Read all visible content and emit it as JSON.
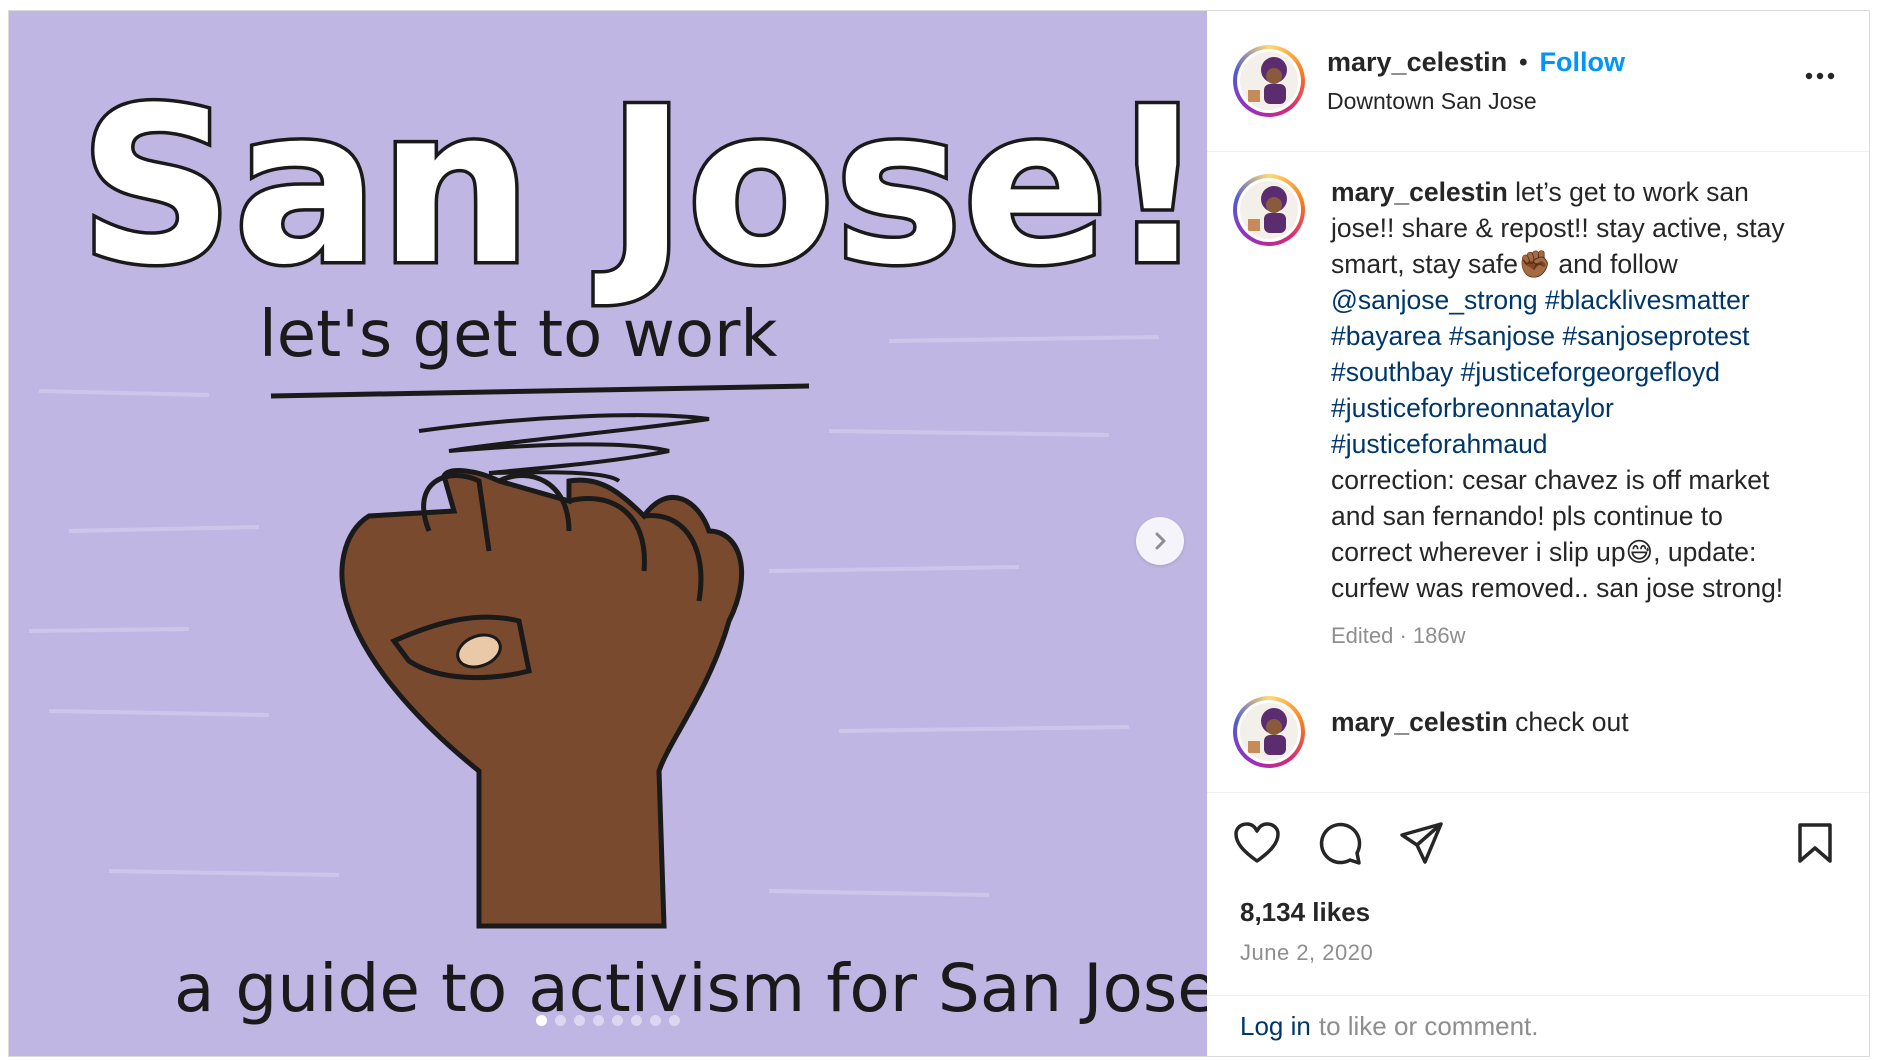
{
  "post": {
    "image": {
      "title_text": "San Jose!",
      "subtitle_text": "let's get to work",
      "footer_text": "a guide to activism for San Jose",
      "background_color": "#c0b6e3",
      "carousel_dots_total": 8,
      "carousel_active_index": 0
    },
    "header": {
      "username": "mary_celestin",
      "separator": "•",
      "follow_label": "Follow",
      "location": "Downtown San Jose",
      "more_icon": "more-horizontal-icon"
    },
    "caption": {
      "username": "mary_celestin",
      "text_1": " let’s get to work san jose!! share & repost!! stay active, stay smart, stay safe✊🏾 and follow ",
      "mention": "@sanjose_strong",
      "hashtags": [
        "#blacklivesmatter",
        "#bayarea",
        "#sanjose",
        "#sanjoseprotest",
        "#southbay",
        "#justiceforgeorgefloyd",
        "#justiceforbreonnataylor",
        "#justiceforahmaud"
      ],
      "text_2": "correction: cesar chavez is off market and san fernando! pls continue to correct wherever i slip up😅, update: curfew was removed.. san jose strong!",
      "meta": "Edited · 186w"
    },
    "second_comment": {
      "username": "mary_celestin",
      "text": " check out"
    },
    "actions": {
      "like_icon": "heart-icon",
      "comment_icon": "comment-icon",
      "share_icon": "share-icon",
      "save_icon": "bookmark-icon"
    },
    "likes": "8,134 likes",
    "date": "June 2, 2020",
    "login": {
      "link": "Log in",
      "text": "to like or comment."
    },
    "colors": {
      "link_blue": "#0095f6",
      "hashtag_blue": "#00376b",
      "muted": "#8e8e8e"
    }
  }
}
